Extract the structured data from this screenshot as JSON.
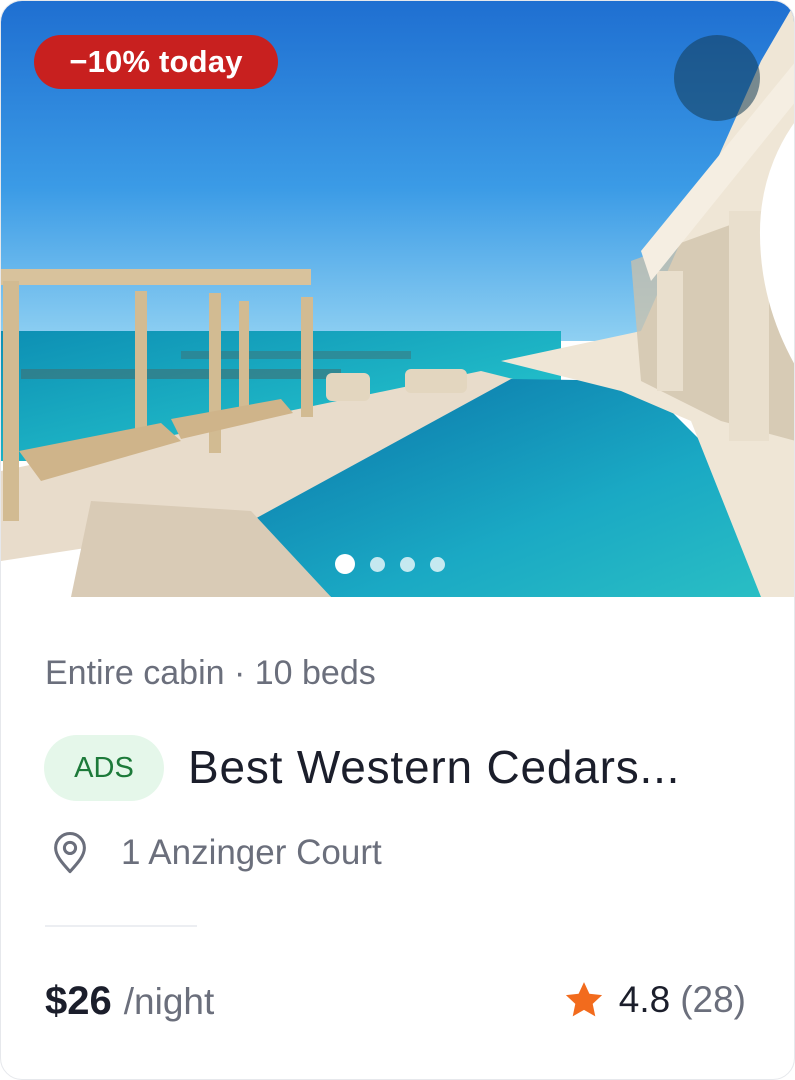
{
  "listing": {
    "discount_badge": "−10% today",
    "favorite_icon": "heart-outline-icon",
    "photo_count": 4,
    "active_photo_index": 0,
    "meta": "Entire cabin · 10 beds",
    "ads_label": "ADS",
    "title": "Best Western Cedars...",
    "location_icon": "map-pin-icon",
    "address": "1 Anzinger Court",
    "price": "$26",
    "price_unit": "/night",
    "rating_icon": "star-icon",
    "rating": "4.8",
    "review_count": "(28)"
  },
  "colors": {
    "discount_badge": "#c8201f",
    "ads_pill_bg": "#e5f7ea",
    "ads_pill_text": "#1d7a3a",
    "star": "#f26b1d",
    "title_text": "#1b1e2b",
    "muted_text": "#6b6f7c"
  }
}
